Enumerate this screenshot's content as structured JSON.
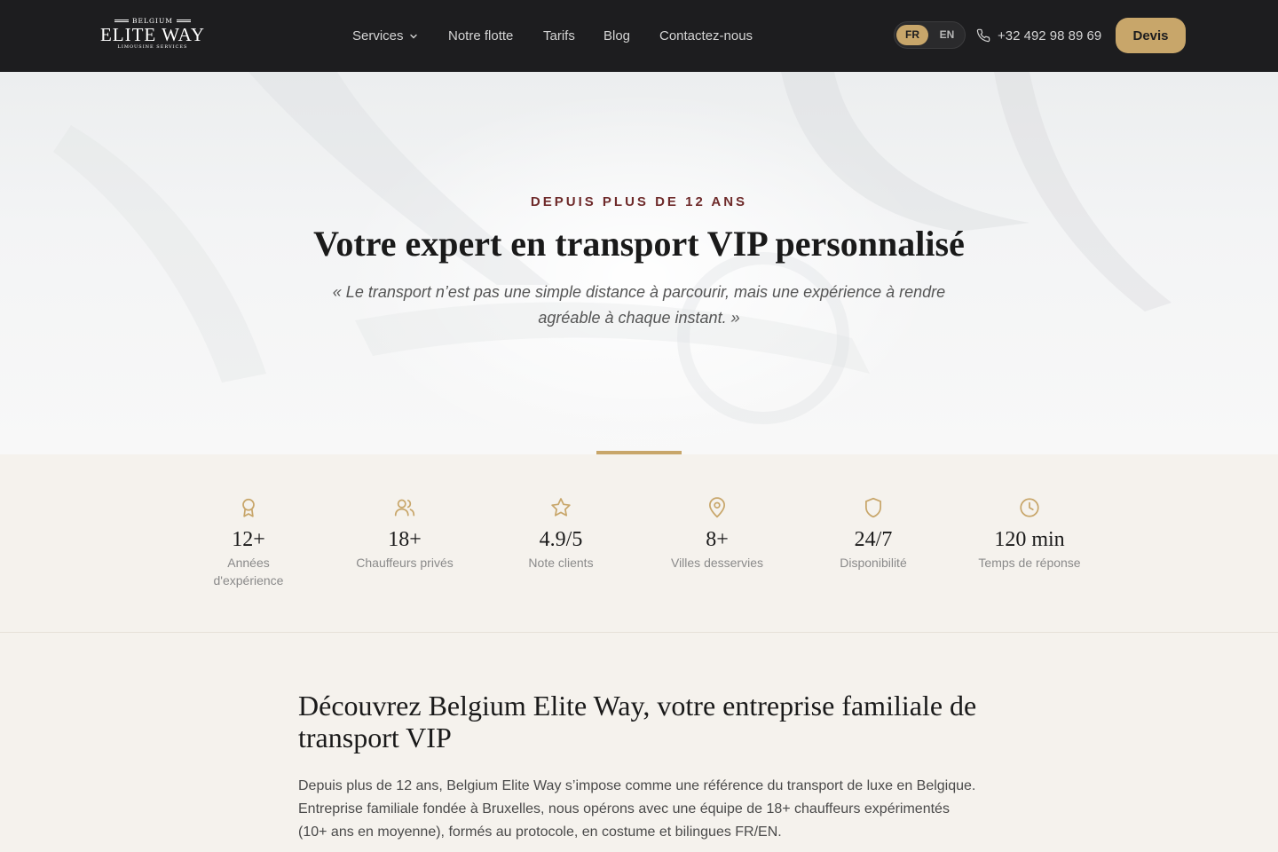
{
  "header": {
    "logo": {
      "top": "BELGIUM",
      "main": "ELITE WAY",
      "sub": "LIMOUSINE SERVICES"
    },
    "nav": [
      {
        "label": "Services",
        "has_dropdown": true
      },
      {
        "label": "Notre flotte"
      },
      {
        "label": "Tarifs"
      },
      {
        "label": "Blog"
      },
      {
        "label": "Contactez-nous"
      }
    ],
    "languages": {
      "active": "FR",
      "fr": "FR",
      "en": "EN"
    },
    "phone": "+32 492 98 89 69",
    "cta": "Devis"
  },
  "hero": {
    "kicker": "DEPUIS PLUS DE 12 ANS",
    "title": "Votre expert en transport VIP personnalisé",
    "quote": "« Le transport n’est pas une simple distance à parcourir, mais une expérience à rendre agréable à chaque instant. »"
  },
  "stats": [
    {
      "icon": "award-icon",
      "value": "12+",
      "label": "Années d'expérience"
    },
    {
      "icon": "users-icon",
      "value": "18+",
      "label": "Chauffeurs privés"
    },
    {
      "icon": "star-icon",
      "value": "4.9/5",
      "label": "Note clients"
    },
    {
      "icon": "map-pin-icon",
      "value": "8+",
      "label": "Villes desservies"
    },
    {
      "icon": "shield-icon",
      "value": "24/7",
      "label": "Disponibilité"
    },
    {
      "icon": "clock-icon",
      "value": "120 min",
      "label": "Temps de réponse"
    }
  ],
  "about": {
    "title": "Découvrez Belgium Elite Way, votre entreprise familiale de transport VIP",
    "text": "Depuis plus de 12 ans, Belgium Elite Way s’impose comme une référence du transport de luxe en Belgique. Entreprise familiale fondée à Bruxelles, nous opérons avec une équipe de 18+ chauffeurs expérimentés (10+ ans en moyenne), formés au protocole, en costume et bilingues FR/EN."
  },
  "colors": {
    "nav_bg": "#1d1d1f",
    "gold": "#c8a66a",
    "kicker": "#6e2a2a",
    "section_bg": "#f5f2ed"
  }
}
